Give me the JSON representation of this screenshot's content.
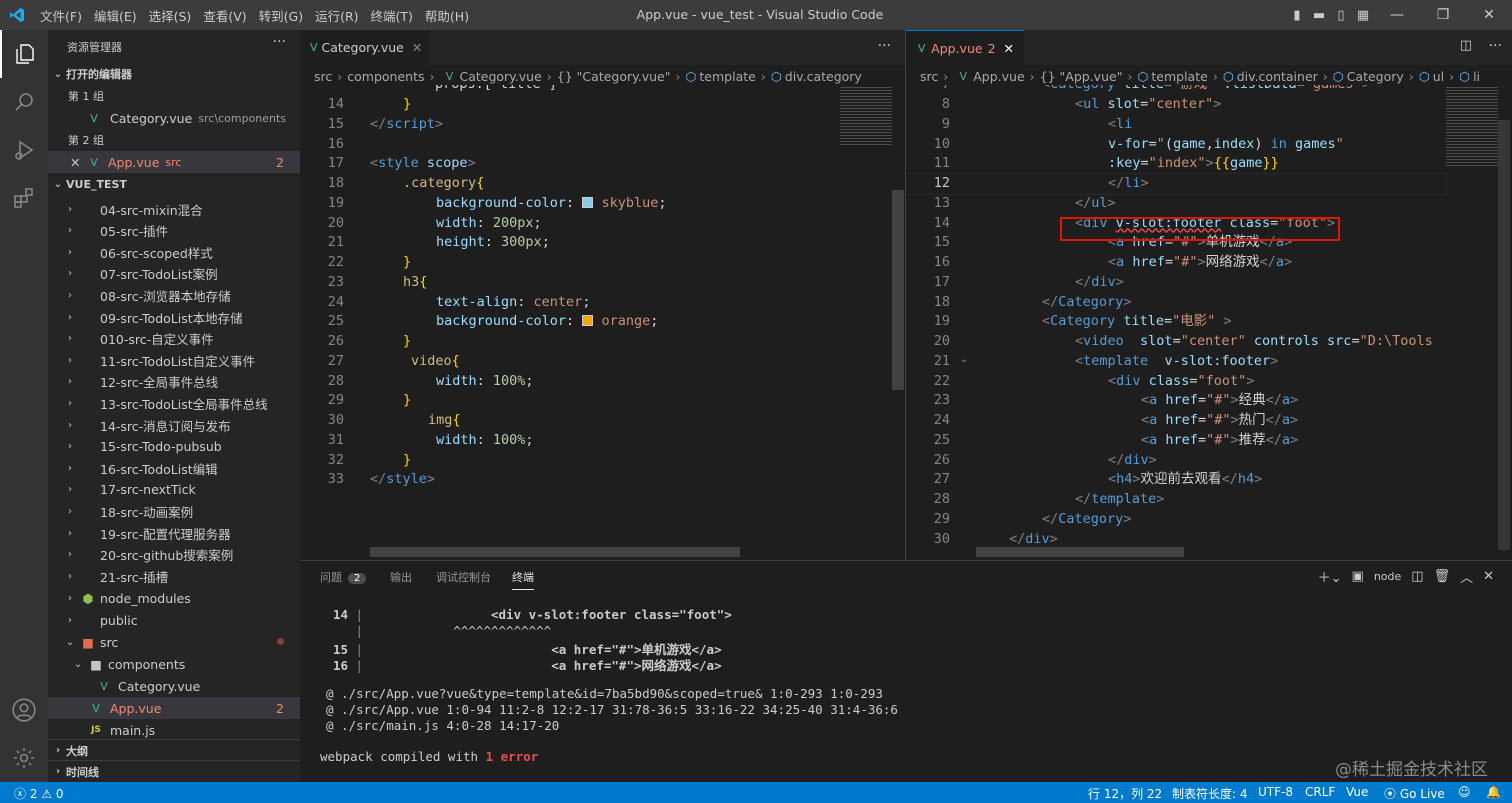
{
  "window": {
    "title": "App.vue - vue_test - Visual Studio Code",
    "menu": [
      "文件(F)",
      "编辑(E)",
      "选择(S)",
      "查看(V)",
      "转到(G)",
      "运行(R)",
      "终端(T)",
      "帮助(H)"
    ]
  },
  "sidebar": {
    "title": "资源管理器",
    "open_editors_label": "打开的编辑器",
    "group1_label": "第 1 组",
    "group1_file": "Category.vue",
    "group1_path": "src\\components",
    "group2_label": "第 2 组",
    "group2_file": "App.vue",
    "group2_path": "src",
    "group2_badge": "2",
    "project_label": "VUE_TEST",
    "folders": [
      "04-src-mixin混合",
      "05-src-插件",
      "06-src-scoped样式",
      "07-src-TodoList案例",
      "08-src-浏览器本地存储",
      "09-src-TodoList本地存储",
      "010-src-自定义事件",
      "11-src-TodoList自定义事件",
      "12-src-全局事件总线",
      "13-src-TodoList全局事件总线",
      "14-src-消息订阅与发布",
      "15-src-Todo-pubsub",
      "16-src-TodoList编辑",
      "17-src-nextTick",
      "18-src-动画案例",
      "19-src-配置代理服务器",
      "20-src-github搜索案例",
      "21-src-插槽"
    ],
    "node_modules": "node_modules",
    "public": "public",
    "src": "src",
    "components": "components",
    "category_file": "Category.vue",
    "app_file": "App.vue",
    "app_badge": "2",
    "main_file": "main.js",
    "outline_label": "大纲",
    "timeline_label": "时间线"
  },
  "left_editor": {
    "tab_label": "Category.vue",
    "breadcrumbs": [
      "src",
      "components",
      "Category.vue",
      "{} \"Category.vue\"",
      "template",
      "div.category"
    ],
    "partial_line": "props:['title']"
  },
  "right_editor": {
    "tab_label": "App.vue",
    "tab_badge": "2",
    "breadcrumbs": [
      "src",
      "App.vue",
      "{} \"App.vue\"",
      "template",
      "div.container",
      "Category",
      "ul",
      "li"
    ]
  },
  "panel": {
    "tabs": [
      "问题",
      "输出",
      "调试控制台",
      "终端"
    ],
    "problems_count": "2",
    "terminal_name": "node",
    "lines": [
      {
        "num": "14",
        "text": "                <div v-slot:footer class=\"foot\">"
      },
      {
        "num": "",
        "text": "           ^^^^^^^^^^^^^"
      },
      {
        "num": "15",
        "text": "                        <a href=\"#\">单机游戏</a>"
      },
      {
        "num": "16",
        "text": "                        <a href=\"#\">网络游戏</a>"
      }
    ],
    "trace": [
      "@ ./src/App.vue?vue&type=template&id=7ba5bd90&scoped=true& 1:0-293 1:0-293",
      "@ ./src/App.vue 1:0-94 11:2-8 12:2-17 31:78-36:5 33:16-22 34:25-40 31:4-36:6",
      "@ ./src/main.js 4:0-28 14:17-20"
    ],
    "compiled_prefix": "webpack compiled with ",
    "compiled_error": "1 error"
  },
  "statusbar": {
    "errors": "2",
    "warnings": "0",
    "position": "行 12，列 22",
    "tab_size": "制表符长度: 4",
    "encoding": "UTF-8",
    "eol": "CRLF",
    "language": "Vue",
    "golive": "Go Live"
  },
  "watermark": "@稀土掘金技术社区",
  "colors": {
    "accent": "#007acc",
    "vue_green": "#41b883",
    "error": "#f48771",
    "highlight_box": "#e51400"
  }
}
